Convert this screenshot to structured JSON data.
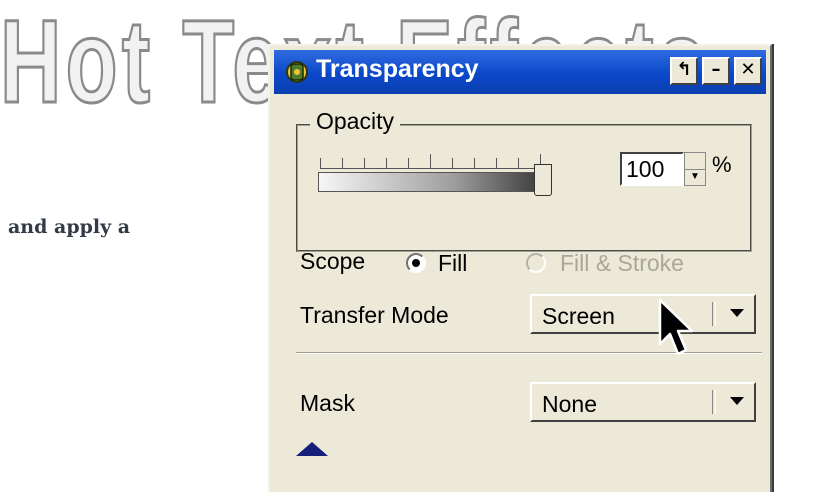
{
  "headline": "Hot Text Effects",
  "side_text": "and apply a",
  "dialog": {
    "title": "Transparency",
    "icon": "gear-icon",
    "title_buttons": {
      "pin": "pin-icon",
      "minimize": "minimize-icon",
      "close": "close-icon"
    }
  },
  "opacity": {
    "group_label": "Opacity",
    "value": "100",
    "unit": "%",
    "slider_level_percent": 100
  },
  "scope": {
    "label": "Scope",
    "options": [
      {
        "label": "Fill",
        "selected": true,
        "enabled": true
      },
      {
        "label": "Fill & Stroke",
        "selected": false,
        "enabled": false
      }
    ]
  },
  "transfer_mode": {
    "label": "Transfer Mode",
    "value": "Screen"
  },
  "mask": {
    "label": "Mask",
    "value": "None"
  },
  "colors": {
    "titlebar": "#0a48c8",
    "dialog_bg": "#ece9d8",
    "expand_arrow": "#14207a"
  }
}
